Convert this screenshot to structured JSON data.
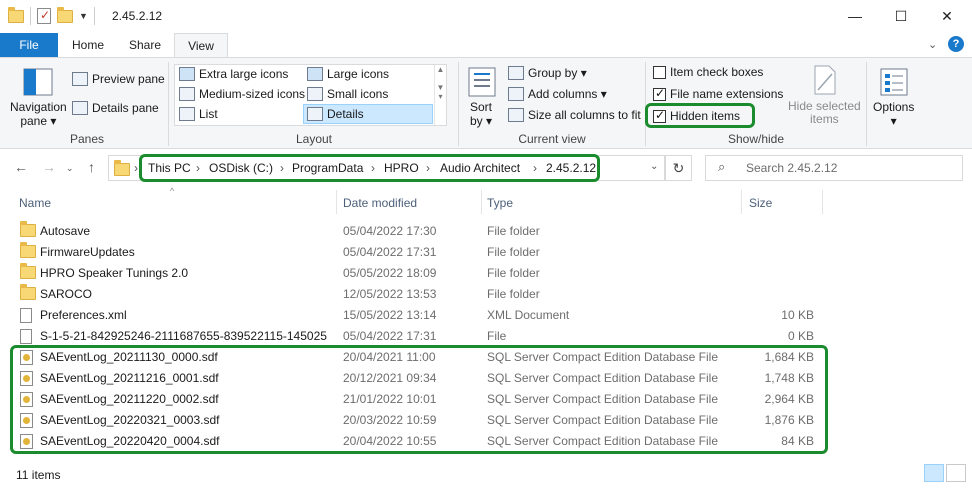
{
  "window": {
    "title": "2.45.2.12",
    "minimize": "—",
    "maximize": "☐",
    "close": "✕"
  },
  "ribbon_tabs": [
    "File",
    "Home",
    "Share",
    "View"
  ],
  "ribbon": {
    "panes": {
      "label": "Panes",
      "navigation_pane": [
        "Navigation",
        "pane ▾"
      ],
      "preview_pane": "Preview pane",
      "details_pane": "Details pane"
    },
    "layout": {
      "label": "Layout",
      "options": [
        "Extra large icons",
        "Large icons",
        "Medium-sized icons",
        "Small icons",
        "List",
        "Details"
      ],
      "selected": "Details"
    },
    "current_view": {
      "label": "Current view",
      "sort_by": [
        "Sort",
        "by ▾"
      ],
      "group_by": "Group by ▾",
      "add_columns": "Add columns ▾",
      "size_all_columns": "Size all columns to fit"
    },
    "show_hide": {
      "label": "Show/hide",
      "item_check_boxes": "Item check boxes",
      "file_name_extensions": "File name extensions",
      "hidden_items": "Hidden items",
      "hide_selected_items": [
        "Hide selected",
        "items"
      ]
    },
    "options": {
      "label": "Options",
      "caret": "▾"
    }
  },
  "address": {
    "breadcrumbs": [
      "This PC",
      "OSDisk (C:)",
      "ProgramData",
      "HPRO",
      "Audio Architect",
      "2.45.2.12"
    ],
    "search_placeholder": "Search 2.45.2.12"
  },
  "columns": [
    "Name",
    "Date modified",
    "Type",
    "Size"
  ],
  "files": [
    {
      "name": "Autosave",
      "date": "05/04/2022 17:30",
      "type": "File folder",
      "size": "",
      "kind": "folder"
    },
    {
      "name": "FirmwareUpdates",
      "date": "05/04/2022 17:31",
      "type": "File folder",
      "size": "",
      "kind": "folder"
    },
    {
      "name": "HPRO Speaker Tunings 2.0",
      "date": "05/05/2022 18:09",
      "type": "File folder",
      "size": "",
      "kind": "folder"
    },
    {
      "name": "SAROCO",
      "date": "12/05/2022 13:53",
      "type": "File folder",
      "size": "",
      "kind": "folder"
    },
    {
      "name": "Preferences.xml",
      "date": "15/05/2022 13:14",
      "type": "XML Document",
      "size": "10 KB",
      "kind": "file"
    },
    {
      "name": "S-1-5-21-842925246-2111687655-839522115-145025",
      "date": "05/04/2022 17:31",
      "type": "File",
      "size": "0 KB",
      "kind": "file"
    },
    {
      "name": "SAEventLog_20211130_0000.sdf",
      "date": "20/04/2021 11:00",
      "type": "SQL Server Compact Edition Database File",
      "size": "1,684 KB",
      "kind": "sdf"
    },
    {
      "name": "SAEventLog_20211216_0001.sdf",
      "date": "20/12/2021 09:34",
      "type": "SQL Server Compact Edition Database File",
      "size": "1,748 KB",
      "kind": "sdf"
    },
    {
      "name": "SAEventLog_20211220_0002.sdf",
      "date": "21/01/2022 10:01",
      "type": "SQL Server Compact Edition Database File",
      "size": "2,964 KB",
      "kind": "sdf"
    },
    {
      "name": "SAEventLog_20220321_0003.sdf",
      "date": "20/03/2022 10:59",
      "type": "SQL Server Compact Edition Database File",
      "size": "1,876 KB",
      "kind": "sdf"
    },
    {
      "name": "SAEventLog_20220420_0004.sdf",
      "date": "20/04/2022 10:55",
      "type": "SQL Server Compact Edition Database File",
      "size": "84 KB",
      "kind": "sdf"
    }
  ],
  "status": {
    "item_count": "11 items"
  },
  "colors": {
    "accent": "#1979ca",
    "highlight_box": "#1b8c2e",
    "folder": "#f8d775"
  }
}
